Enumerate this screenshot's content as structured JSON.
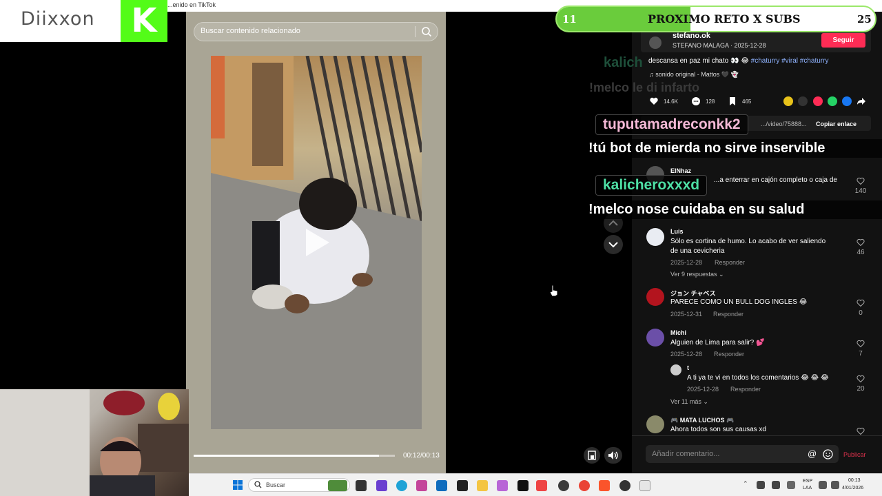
{
  "brand": {
    "name": "Diixxon",
    "logo_letter": "K",
    "logo_color": "#53fc18"
  },
  "browser": {
    "tab_title": "...enido en TikTok"
  },
  "video": {
    "search_placeholder": "Buscar contenido relacionado",
    "time": "00:12/00:13",
    "progress": 0.92
  },
  "reto": {
    "left_value": "11",
    "title": "PROXIMO RETO X SUBS",
    "right_value": "25",
    "fill_fraction": 0.42,
    "accent": "#6acc3c"
  },
  "author": {
    "handle": "stefano.ok",
    "meta": "STEFANO MALAGA · 2025-12-28",
    "follow_label": "Seguir",
    "caption": "descansa en paz mi chato 👀 😂",
    "tags": "#chaturry #viral #chaturry",
    "sound": "sonido original - Mattos 🖤 👻"
  },
  "stats": {
    "likes": "14.6K",
    "comments": "128",
    "saves": "465"
  },
  "link": {
    "url": ".../video/75888...",
    "copy_label": "Copiar enlace"
  },
  "overlay_chat": {
    "ghost_user": "kalich",
    "ghost_msg": "!melco le di infarto",
    "user1": "tuputamadreconkk2",
    "msg1": "!tú bot de mierda no sirve inservible",
    "user2": "kalicheroxxxd",
    "msg2": "!melco nose cuidaba en su salud",
    "user1_color": "#f4b9d6",
    "user2_color": "#4ee0a5"
  },
  "comments": [
    {
      "name": "ElNhaz",
      "text": "...a enterrar en cajón completo o caja de",
      "count": "140"
    },
    {
      "name": "Luis",
      "text1": "Sólo es cortina de humo. Lo acabo de ver saliendo",
      "text2": "de una cevicheria",
      "date": "2025-12-28",
      "reply": "Responder",
      "count": "46",
      "more": "Ver 9 respuestas"
    },
    {
      "name": "ジョン チャベス",
      "text": "PARECE COMO UN BULL DOG INGLES 😂",
      "date": "2025-12-31",
      "reply": "Responder",
      "count": "0"
    },
    {
      "name": "Michi",
      "text": "Alguien de Lima para salir? 💕",
      "date": "2025-12-28",
      "reply": "Responder",
      "count": "7"
    },
    {
      "name": "t",
      "text": "A ti ya te vi en todos los comentarios 😂 😂 😂",
      "date": "2025-12-28",
      "reply": "Responder",
      "count": "20",
      "more": "Ver 11 más"
    },
    {
      "name": "🎮 MATA LUCHOS 🎮",
      "text": "Ahora todos son sus causas xd"
    }
  ],
  "comment_input": {
    "placeholder": "Añadir comentario...",
    "publish": "Publicar"
  },
  "taskbar": {
    "search_label": "Buscar",
    "lang1": "ESP",
    "lang2": "LAA",
    "time": "00:13",
    "date": "4/01/2026"
  }
}
